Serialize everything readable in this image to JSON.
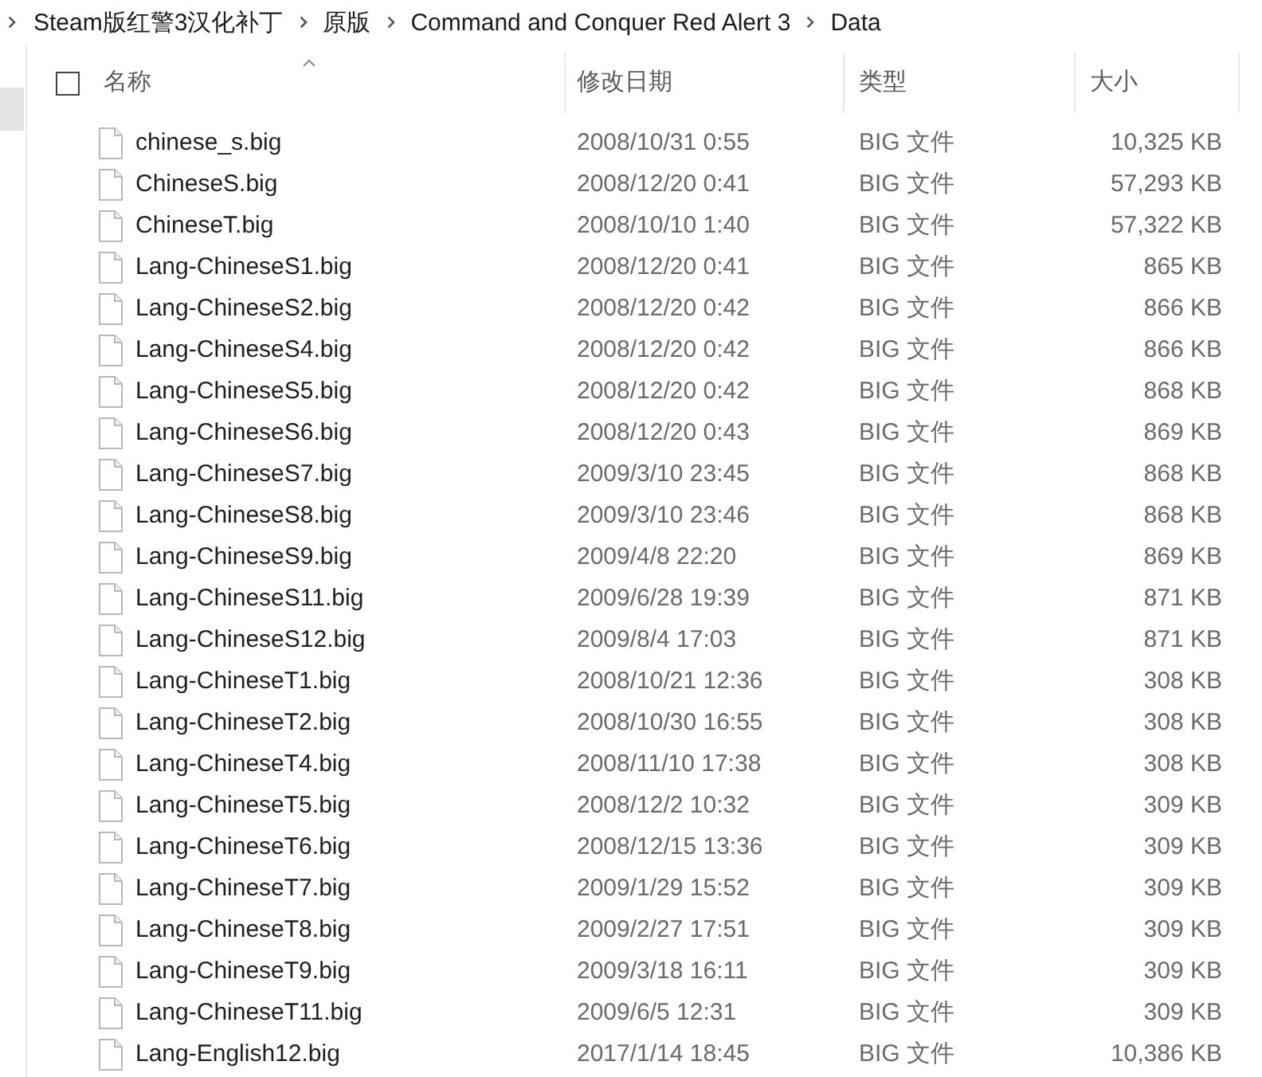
{
  "breadcrumb": [
    "Steam版红警3汉化补丁",
    "原版",
    "Command and Conquer Red Alert 3",
    "Data"
  ],
  "select_all": {
    "checked": false
  },
  "columns": [
    {
      "label": "名称",
      "sorted": true
    },
    {
      "label": "修改日期",
      "sorted": false
    },
    {
      "label": "类型",
      "sorted": false
    },
    {
      "label": "大小",
      "sorted": false
    }
  ],
  "rows": [
    {
      "name": "chinese_s.big",
      "modified": "2008/10/31 0:55",
      "type": "BIG 文件",
      "size": "10,325 KB"
    },
    {
      "name": "ChineseS.big",
      "modified": "2008/12/20 0:41",
      "type": "BIG 文件",
      "size": "57,293 KB"
    },
    {
      "name": "ChineseT.big",
      "modified": "2008/10/10 1:40",
      "type": "BIG 文件",
      "size": "57,322 KB"
    },
    {
      "name": "Lang-ChineseS1.big",
      "modified": "2008/12/20 0:41",
      "type": "BIG 文件",
      "size": "865 KB"
    },
    {
      "name": "Lang-ChineseS2.big",
      "modified": "2008/12/20 0:42",
      "type": "BIG 文件",
      "size": "866 KB"
    },
    {
      "name": "Lang-ChineseS4.big",
      "modified": "2008/12/20 0:42",
      "type": "BIG 文件",
      "size": "866 KB"
    },
    {
      "name": "Lang-ChineseS5.big",
      "modified": "2008/12/20 0:42",
      "type": "BIG 文件",
      "size": "868 KB"
    },
    {
      "name": "Lang-ChineseS6.big",
      "modified": "2008/12/20 0:43",
      "type": "BIG 文件",
      "size": "869 KB"
    },
    {
      "name": "Lang-ChineseS7.big",
      "modified": "2009/3/10 23:45",
      "type": "BIG 文件",
      "size": "868 KB"
    },
    {
      "name": "Lang-ChineseS8.big",
      "modified": "2009/3/10 23:46",
      "type": "BIG 文件",
      "size": "868 KB"
    },
    {
      "name": "Lang-ChineseS9.big",
      "modified": "2009/4/8 22:20",
      "type": "BIG 文件",
      "size": "869 KB"
    },
    {
      "name": "Lang-ChineseS11.big",
      "modified": "2009/6/28 19:39",
      "type": "BIG 文件",
      "size": "871 KB"
    },
    {
      "name": "Lang-ChineseS12.big",
      "modified": "2009/8/4 17:03",
      "type": "BIG 文件",
      "size": "871 KB"
    },
    {
      "name": "Lang-ChineseT1.big",
      "modified": "2008/10/21 12:36",
      "type": "BIG 文件",
      "size": "308 KB"
    },
    {
      "name": "Lang-ChineseT2.big",
      "modified": "2008/10/30 16:55",
      "type": "BIG 文件",
      "size": "308 KB"
    },
    {
      "name": "Lang-ChineseT4.big",
      "modified": "2008/11/10 17:38",
      "type": "BIG 文件",
      "size": "308 KB"
    },
    {
      "name": "Lang-ChineseT5.big",
      "modified": "2008/12/2 10:32",
      "type": "BIG 文件",
      "size": "309 KB"
    },
    {
      "name": "Lang-ChineseT6.big",
      "modified": "2008/12/15 13:36",
      "type": "BIG 文件",
      "size": "309 KB"
    },
    {
      "name": "Lang-ChineseT7.big",
      "modified": "2009/1/29 15:52",
      "type": "BIG 文件",
      "size": "309 KB"
    },
    {
      "name": "Lang-ChineseT8.big",
      "modified": "2009/2/27 17:51",
      "type": "BIG 文件",
      "size": "309 KB"
    },
    {
      "name": "Lang-ChineseT9.big",
      "modified": "2009/3/18 16:11",
      "type": "BIG 文件",
      "size": "309 KB"
    },
    {
      "name": "Lang-ChineseT11.big",
      "modified": "2009/6/5 12:31",
      "type": "BIG 文件",
      "size": "309 KB"
    },
    {
      "name": "Lang-English12.big",
      "modified": "2017/1/14 18:45",
      "type": "BIG 文件",
      "size": "10,386 KB"
    }
  ]
}
